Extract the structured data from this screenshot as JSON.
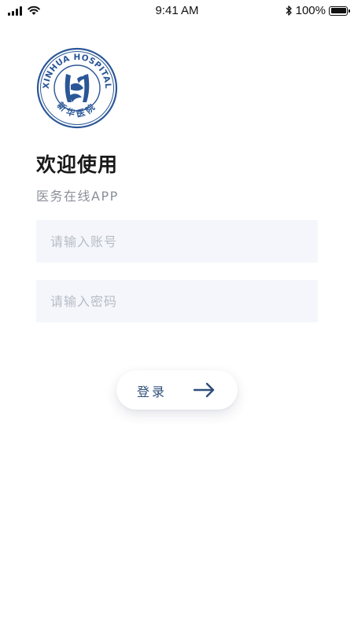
{
  "status_bar": {
    "time": "9:41 AM",
    "battery": "100%",
    "battery_level": 1.0,
    "icons": [
      "signal-icon",
      "wifi-icon",
      "bluetooth-icon",
      "battery-icon"
    ]
  },
  "logo": {
    "ring_text_top": "XINHUA HOSPITAL",
    "ring_text_bottom": "新华医院",
    "color": "#2b5797"
  },
  "welcome": {
    "title": "欢迎使用",
    "subtitle": "医务在线APP"
  },
  "form": {
    "account_placeholder": "请输入账号",
    "password_placeholder": "请输入密码",
    "login_label": "登录",
    "login_icon": "arrow-right-icon"
  },
  "colors": {
    "accent": "#2f4f7a",
    "field_bg": "#f4f6fb",
    "placeholder": "#b7bcc6",
    "subtitle": "#8a8f98"
  }
}
